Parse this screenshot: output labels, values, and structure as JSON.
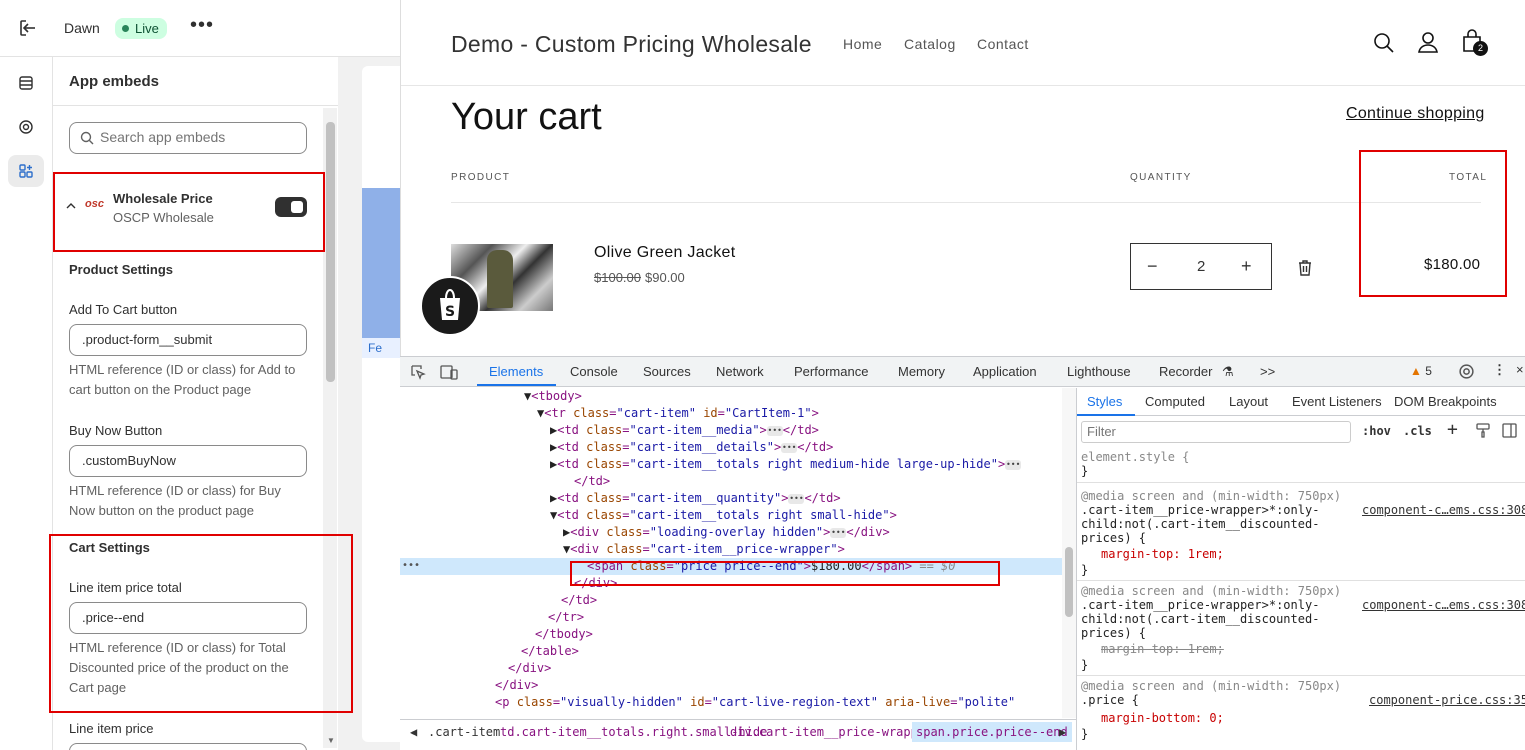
{
  "editor": {
    "theme_name": "Dawn",
    "live_badge": "Live",
    "more": "•••",
    "panel_title": "App embeds",
    "search_placeholder": "Search app embeds",
    "embed": {
      "logo": "osc",
      "name": "Wholesale Price",
      "subtitle": "OSCP Wholesale",
      "enabled": true
    },
    "product_settings": "Product Settings",
    "fields": [
      {
        "label": "Add To Cart button",
        "value": ".product-form__submit",
        "help": "HTML reference (ID or class) for Add to cart button on the Product page"
      },
      {
        "label": "Buy Now Button",
        "value": ".customBuyNow",
        "help": "HTML reference (ID or class) for Buy Now button on the product page"
      }
    ],
    "cart_settings": "Cart Settings",
    "cart_fields": [
      {
        "label": "Line item price total",
        "value": ".price--end",
        "help": "HTML reference (ID or class) for Total Discounted price of the product on the Cart page"
      },
      {
        "label": "Line item price"
      }
    ],
    "preview_fe": "Fe"
  },
  "store": {
    "title": "Demo - Custom Pricing Wholesale",
    "nav": [
      "Home",
      "Catalog",
      "Contact"
    ],
    "cart_count": "2",
    "cart_heading": "Your cart",
    "continue": "Continue shopping",
    "col_product": "PRODUCT",
    "col_quantity": "QUANTITY",
    "col_total": "TOTAL",
    "item": {
      "name": "Olive Green Jacket",
      "old_price": "$100.00",
      "price": "$90.00",
      "qty_minus": "−",
      "qty": "2",
      "qty_plus": "+",
      "total": "$180.00"
    }
  },
  "devtools": {
    "tabs": [
      "Elements",
      "Console",
      "Sources",
      "Network",
      "Performance",
      "Memory",
      "Application",
      "Lighthouse",
      "Recorder"
    ],
    "more_tabs": ">>",
    "warnings": "5",
    "side_tabs": [
      "Styles",
      "Computed",
      "Layout",
      "Event Listeners",
      "DOM Breakpoints"
    ],
    "filter_placeholder": "Filter",
    "hov": ":hov",
    "cls": ".cls",
    "breadcrumbs": [
      ".cart-item",
      "td.cart-item__totals.right.small-hide",
      "div.cart-item__price-wrapper",
      "span.price.price--end"
    ],
    "dom_gutter": "•••",
    "dom": [
      {
        "t": "<tbody>"
      },
      {
        "t": "<tr class=\"cart-item\" id=\"CartItem-1\">"
      },
      {
        "t": "<td class=\"cart-item__media\">…</td>"
      },
      {
        "t": "<td class=\"cart-item__details\">…</td>"
      },
      {
        "t": "<td class=\"cart-item__totals right medium-hide large-up-hide\">…"
      },
      {
        "t": "</td>"
      },
      {
        "t": "<td class=\"cart-item__quantity\">…</td>"
      },
      {
        "t": "<td class=\"cart-item__totals right small-hide\">"
      },
      {
        "t": "<div class=\"loading-overlay hidden\">…</div>"
      },
      {
        "t": "<div class=\"cart-item__price-wrapper\">"
      },
      {
        "t": "<span class=\"price price--end\">$180.00</span> == $0"
      },
      {
        "t": "</div>"
      },
      {
        "t": "</td>"
      },
      {
        "t": "</tr>"
      },
      {
        "t": "</tbody>"
      },
      {
        "t": "</table>"
      },
      {
        "t": "</div>"
      },
      {
        "t": "</div>"
      },
      {
        "t": "<p class=\"visually-hidden\" id=\"cart-live-region-text\" aria-live=\"polite\""
      }
    ],
    "styles": {
      "element_style": "element.style {",
      "rule1_media": "@media screen and (min-width: 750px)",
      "rule1_sel": ".cart-item__price-wrapper>*:only-\nchild:not(.cart-item__discounted-\nprices) {",
      "rule1_prop": "margin-top: 1rem;",
      "rule1_src": "component-c…ems.css:308",
      "rule2_media": "@media screen and (min-width: 750px)",
      "rule2_sel": ".cart-item__price-wrapper>*:only-\nchild:not(.cart-item__discounted-\nprices) {",
      "rule2_prop": "margin-top: 1rem;",
      "rule2_src": "component-c…ems.css:308",
      "rule3_media": "@media screen and (min-width: 750px)",
      "rule3_sel": ".price {",
      "rule3_prop": "margin-bottom: 0;",
      "rule3_src": "component-price.css:35",
      "close": "}"
    }
  }
}
